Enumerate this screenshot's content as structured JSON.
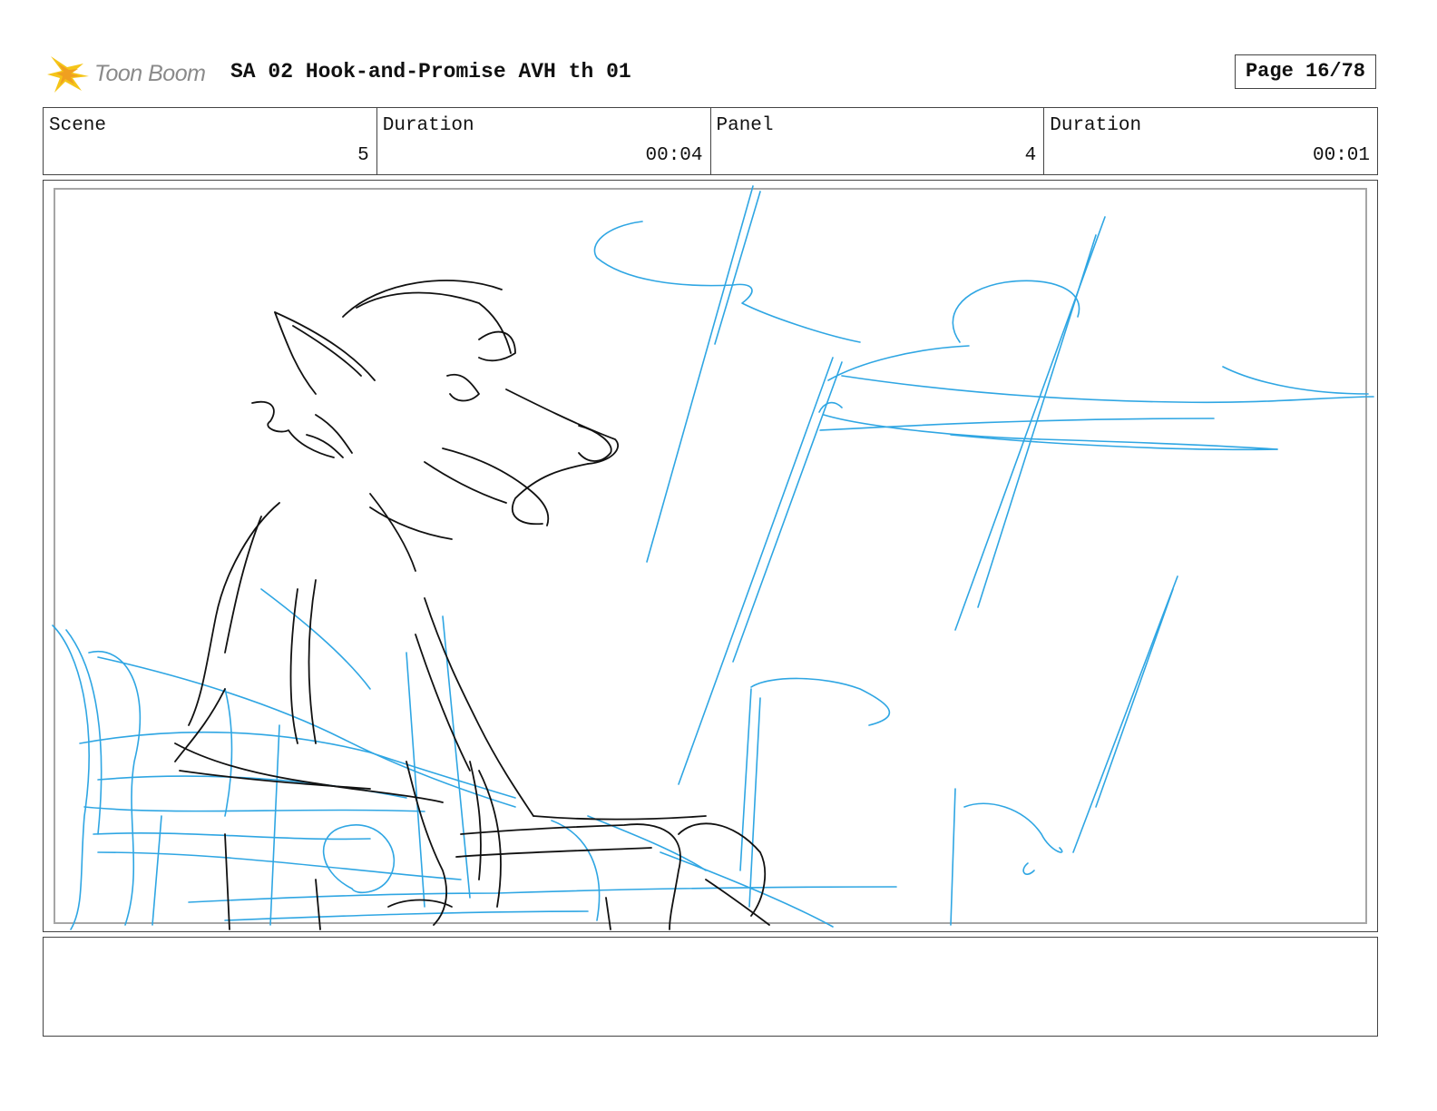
{
  "header": {
    "brand": "Toon Boom",
    "title": "SA 02 Hook-and-Promise AVH th 01",
    "page": "Page 16/78"
  },
  "info": {
    "scene_label": "Scene",
    "scene_value": "5",
    "scene_duration_label": "Duration",
    "scene_duration_value": "00:04",
    "panel_label": "Panel",
    "panel_value": "4",
    "panel_duration_label": "Duration",
    "panel_duration_value": "00:01"
  },
  "colors": {
    "rough_blue": "#2fa6e3",
    "ink_black": "#111111",
    "logo_yellow": "#f5c518"
  },
  "notes": ""
}
